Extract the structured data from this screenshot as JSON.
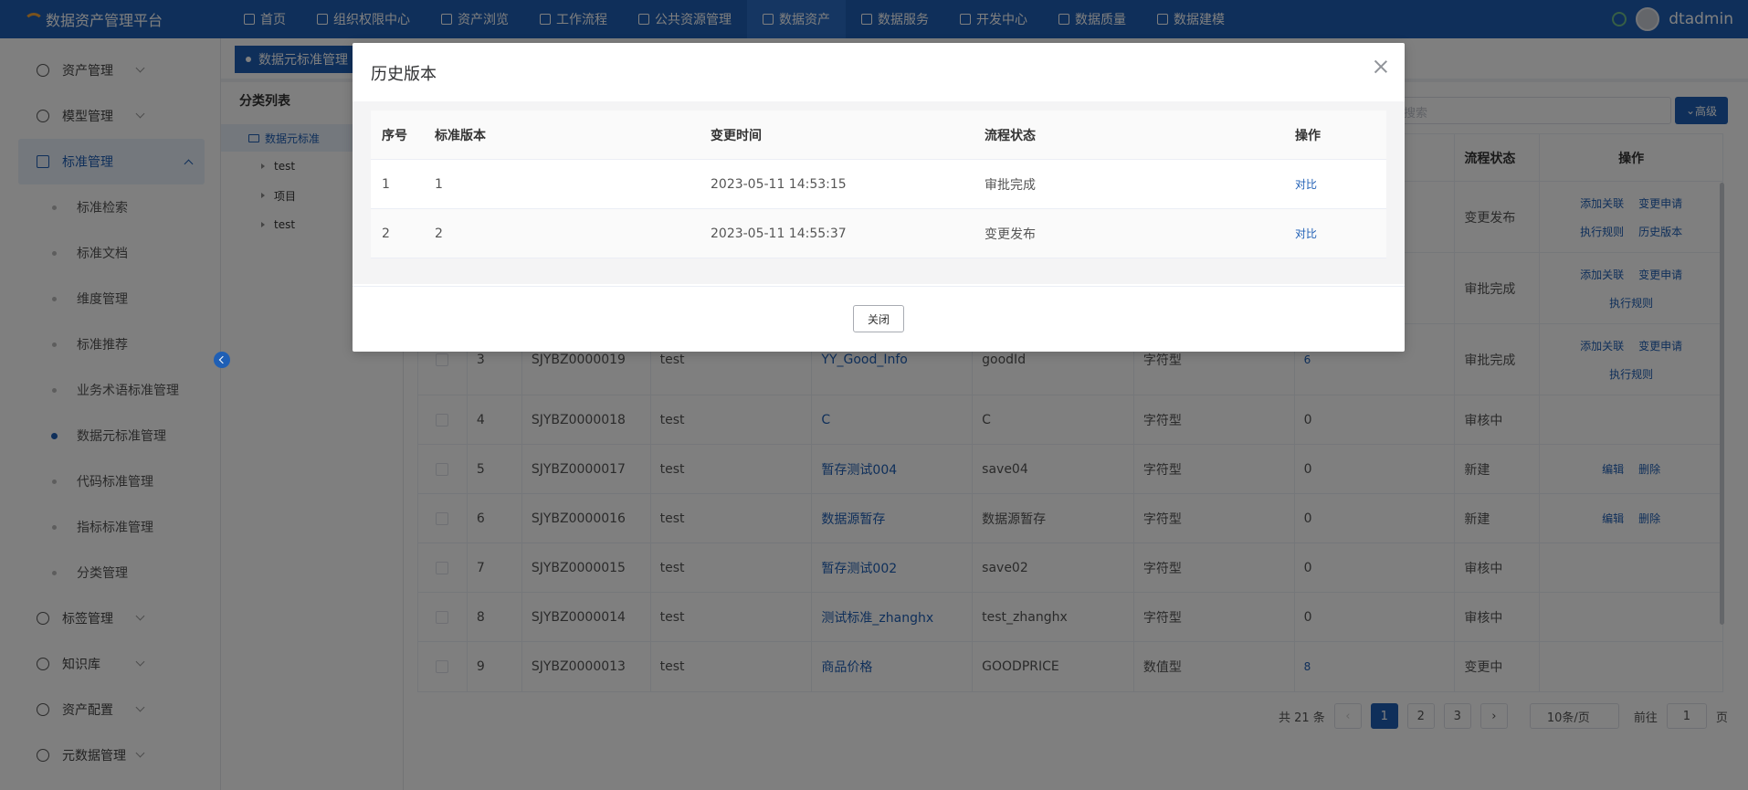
{
  "app": {
    "title": "数据资产管理平台",
    "user": "dtadmin"
  },
  "nav": [
    {
      "label": "首页",
      "icon": "document-icon"
    },
    {
      "label": "组织权限中心",
      "icon": "shield-icon"
    },
    {
      "label": "资产浏览",
      "icon": "grid-icon"
    },
    {
      "label": "工作流程",
      "icon": "scale-icon"
    },
    {
      "label": "公共资源管理",
      "icon": "users-icon"
    },
    {
      "label": "数据资产",
      "icon": "database-icon",
      "active": true
    },
    {
      "label": "数据服务",
      "icon": "chart-icon"
    },
    {
      "label": "开发中心",
      "icon": "edit-icon"
    },
    {
      "label": "数据质量",
      "icon": "bar-chart-icon"
    },
    {
      "label": "数据建模",
      "icon": "layers-icon"
    }
  ],
  "sidebar": {
    "groups": [
      {
        "label": "资产管理"
      },
      {
        "label": "模型管理"
      },
      {
        "label": "标准管理",
        "open": true
      },
      {
        "label": "标签管理"
      },
      {
        "label": "知识库"
      },
      {
        "label": "资产配置"
      },
      {
        "label": "元数据管理"
      }
    ],
    "subitems": [
      {
        "label": "标准检索"
      },
      {
        "label": "标准文档"
      },
      {
        "label": "维度管理"
      },
      {
        "label": "标准推荐"
      },
      {
        "label": "业务术语标准管理"
      },
      {
        "label": "数据元标准管理",
        "active": true
      },
      {
        "label": "代码标准管理"
      },
      {
        "label": "指标标准管理"
      },
      {
        "label": "分类管理"
      }
    ]
  },
  "tab": {
    "label": "数据元标准管理"
  },
  "tree": {
    "title": "分类列表",
    "root": "数据元标准",
    "nodes": [
      "test",
      "项目",
      "test"
    ]
  },
  "search": {
    "placeholder": "搜索",
    "advanced": "高级"
  },
  "grid": {
    "headers": {
      "flow": "流程状态",
      "ops": "操作"
    },
    "rows": [
      {
        "flow": "变更发布",
        "ops": [
          [
            "添加关联",
            "变更申请"
          ],
          [
            "执行规则",
            "历史版本"
          ]
        ]
      },
      {
        "flow": "审批完成",
        "ops": [
          [
            "添加关联",
            "变更申请"
          ],
          [
            "执行规则"
          ]
        ]
      },
      {
        "idx": "3",
        "code": "SJYBZ0000019",
        "cls": "test",
        "name": "YY_Good_Info",
        "en": "goodId",
        "type": "字符型",
        "cnt": "6",
        "flow": "审批完成",
        "ops": [
          [
            "添加关联",
            "变更申请"
          ],
          [
            "执行规则"
          ]
        ]
      },
      {
        "idx": "4",
        "code": "SJYBZ0000018",
        "cls": "test",
        "name": "C",
        "en": "C",
        "type": "字符型",
        "cnt": "0",
        "flow": "审核中",
        "ops": []
      },
      {
        "idx": "5",
        "code": "SJYBZ0000017",
        "cls": "test",
        "name": "暂存测试004",
        "en": "save04",
        "type": "字符型",
        "cnt": "0",
        "flow": "新建",
        "ops": [
          [
            "编辑",
            "删除"
          ]
        ]
      },
      {
        "idx": "6",
        "code": "SJYBZ0000016",
        "cls": "test",
        "name": "数据源暂存",
        "en": "数据源暂存",
        "type": "字符型",
        "cnt": "0",
        "flow": "新建",
        "ops": [
          [
            "编辑",
            "删除"
          ]
        ]
      },
      {
        "idx": "7",
        "code": "SJYBZ0000015",
        "cls": "test",
        "name": "暂存测试002",
        "en": "save02",
        "type": "字符型",
        "cnt": "0",
        "flow": "审核中",
        "ops": []
      },
      {
        "idx": "8",
        "code": "SJYBZ0000014",
        "cls": "test",
        "name": "测试标准_zhanghx",
        "en": "test_zhanghx",
        "type": "字符型",
        "cnt": "0",
        "flow": "审核中",
        "ops": []
      },
      {
        "idx": "9",
        "code": "SJYBZ0000013",
        "cls": "test",
        "name": "商品价格",
        "en": "GOODPRICE",
        "type": "数值型",
        "cnt": "8",
        "flow": "变更中",
        "ops": []
      }
    ]
  },
  "pager": {
    "total": "共 21 条",
    "pages": [
      "1",
      "2",
      "3"
    ],
    "size": "10条/页",
    "goto": "前往",
    "goto_value": "1",
    "page_unit": "页"
  },
  "dialog": {
    "title": "历史版本",
    "headers": {
      "idx": "序号",
      "ver": "标准版本",
      "time": "变更时间",
      "flow": "流程状态",
      "op": "操作"
    },
    "rows": [
      {
        "idx": "1",
        "ver": "1",
        "time": "2023-05-11 14:53:15",
        "flow": "审批完成",
        "op": "对比"
      },
      {
        "idx": "2",
        "ver": "2",
        "time": "2023-05-11 14:55:37",
        "flow": "变更发布",
        "op": "对比"
      }
    ],
    "close_button": "关闭"
  }
}
